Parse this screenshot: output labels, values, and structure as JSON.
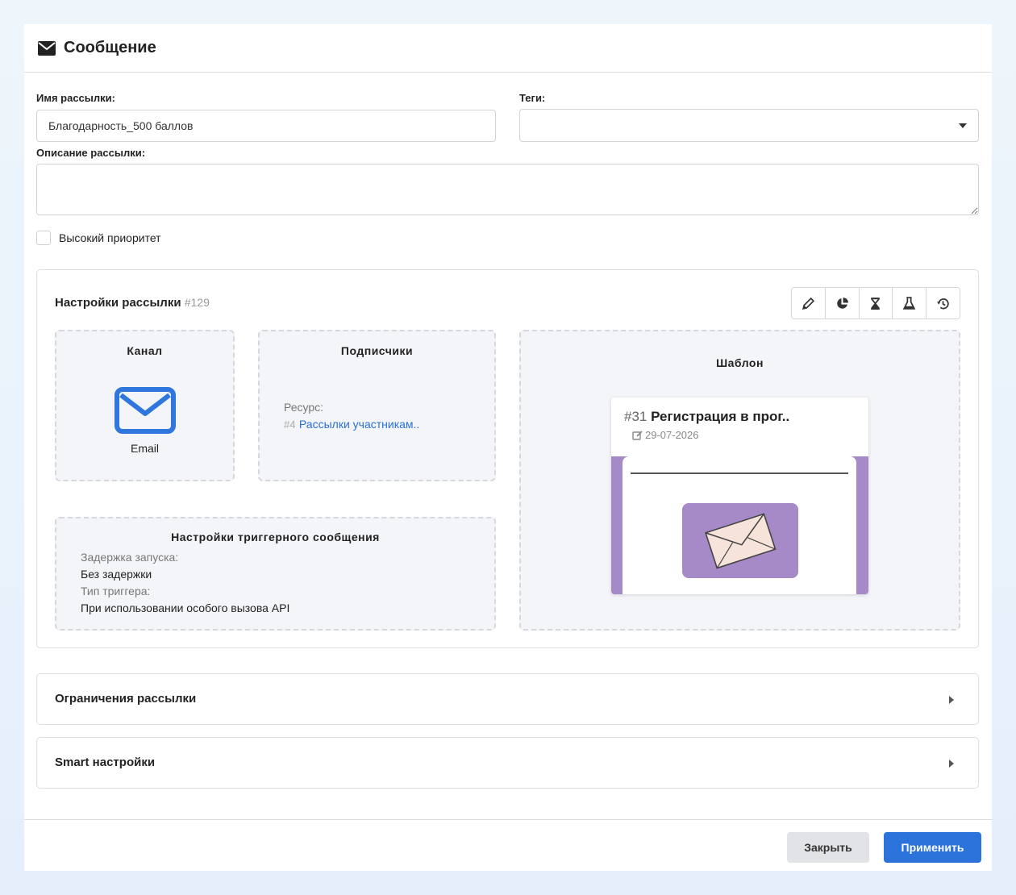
{
  "header": {
    "title": "Сообщение",
    "icon": "envelope-icon"
  },
  "form": {
    "name_label": "Имя рассылки:",
    "name_value": "Благодарность_500 баллов",
    "tags_label": "Теги:",
    "tags_value": "",
    "description_label": "Описание рассылки:",
    "description_value": "",
    "priority_label": "Высокий приоритет",
    "priority_checked": false
  },
  "settings": {
    "title": "Настройки рассылки",
    "id": "#129",
    "toolbar": [
      "pencil-icon",
      "pie-chart-icon",
      "hourglass-icon",
      "flask-icon",
      "history-icon"
    ],
    "channel": {
      "title": "Канал",
      "value": "Email",
      "icon": "envelope-outline-icon"
    },
    "subscribers": {
      "title": "Подписчики",
      "resource_label": "Ресурс:",
      "resource_id": "#4",
      "resource_name": "Рассылки участникам.."
    },
    "template": {
      "title": "Шаблон",
      "number": "#31",
      "name": "Регистрация в прог..",
      "date": "29-07-2026"
    },
    "trigger": {
      "title": "Настройки триггерного сообщения",
      "delay_label": "Задержка запуска:",
      "delay_value": "Без задержки",
      "type_label": "Тип триггера:",
      "type_value": "При использовании особого вызова API"
    }
  },
  "accordions": {
    "limits": "Ограничения рассылки",
    "smart": "Smart настройки"
  },
  "footer": {
    "close_label": "Закрыть",
    "apply_label": "Применить"
  },
  "colors": {
    "primary": "#2b73db",
    "template_bg": "#a58ac7",
    "link": "#2a6fd6"
  }
}
